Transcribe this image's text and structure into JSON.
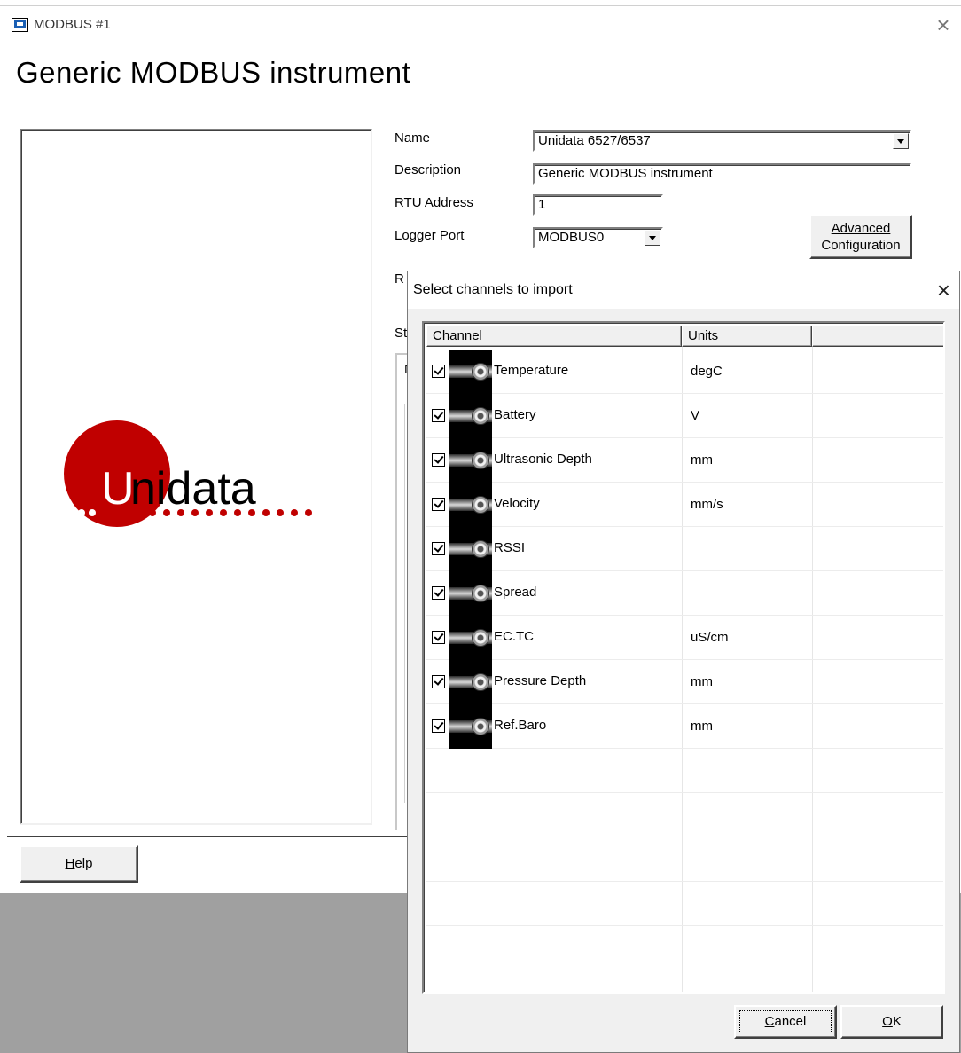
{
  "window": {
    "title": "MODBUS #1",
    "heading": "Generic MODBUS instrument",
    "close_glyph": "×"
  },
  "logo": {
    "text": "Unidata",
    "red": "#c00000"
  },
  "form": {
    "name_label": "Name",
    "name_value": "Unidata 6527/6537",
    "description_label": "Description",
    "description_value": "Generic MODBUS instrument",
    "rtu_label": "RTU Address",
    "rtu_value": "1",
    "port_label": "Logger Port",
    "port_value": "MODBUS0",
    "adv_line1": "Advanced",
    "adv_line2": "Configuration",
    "hidden_label_1": "R",
    "hidden_label_2": "St",
    "hidden_label_3": "N"
  },
  "help_button": {
    "label": "Help",
    "accel": "H",
    "rest": "elp"
  },
  "dialog": {
    "title": "Select channels to import",
    "close_glyph": "×",
    "columns": [
      "Channel",
      "Units",
      ""
    ],
    "channels": [
      {
        "name": "Temperature",
        "units": "degC",
        "checked": true
      },
      {
        "name": "Battery",
        "units": "V",
        "checked": true
      },
      {
        "name": "Ultrasonic Depth",
        "units": "mm",
        "checked": true
      },
      {
        "name": "Velocity",
        "units": "mm/s",
        "checked": true
      },
      {
        "name": "RSSI",
        "units": "",
        "checked": true
      },
      {
        "name": "Spread",
        "units": "",
        "checked": true
      },
      {
        "name": "EC.TC",
        "units": "uS/cm",
        "checked": true
      },
      {
        "name": "Pressure Depth",
        "units": "mm",
        "checked": true
      },
      {
        "name": "Ref.Baro",
        "units": "mm",
        "checked": true
      }
    ],
    "cancel": {
      "accel": "C",
      "rest": "ancel"
    },
    "ok": {
      "accel": "O",
      "rest": "K"
    }
  }
}
